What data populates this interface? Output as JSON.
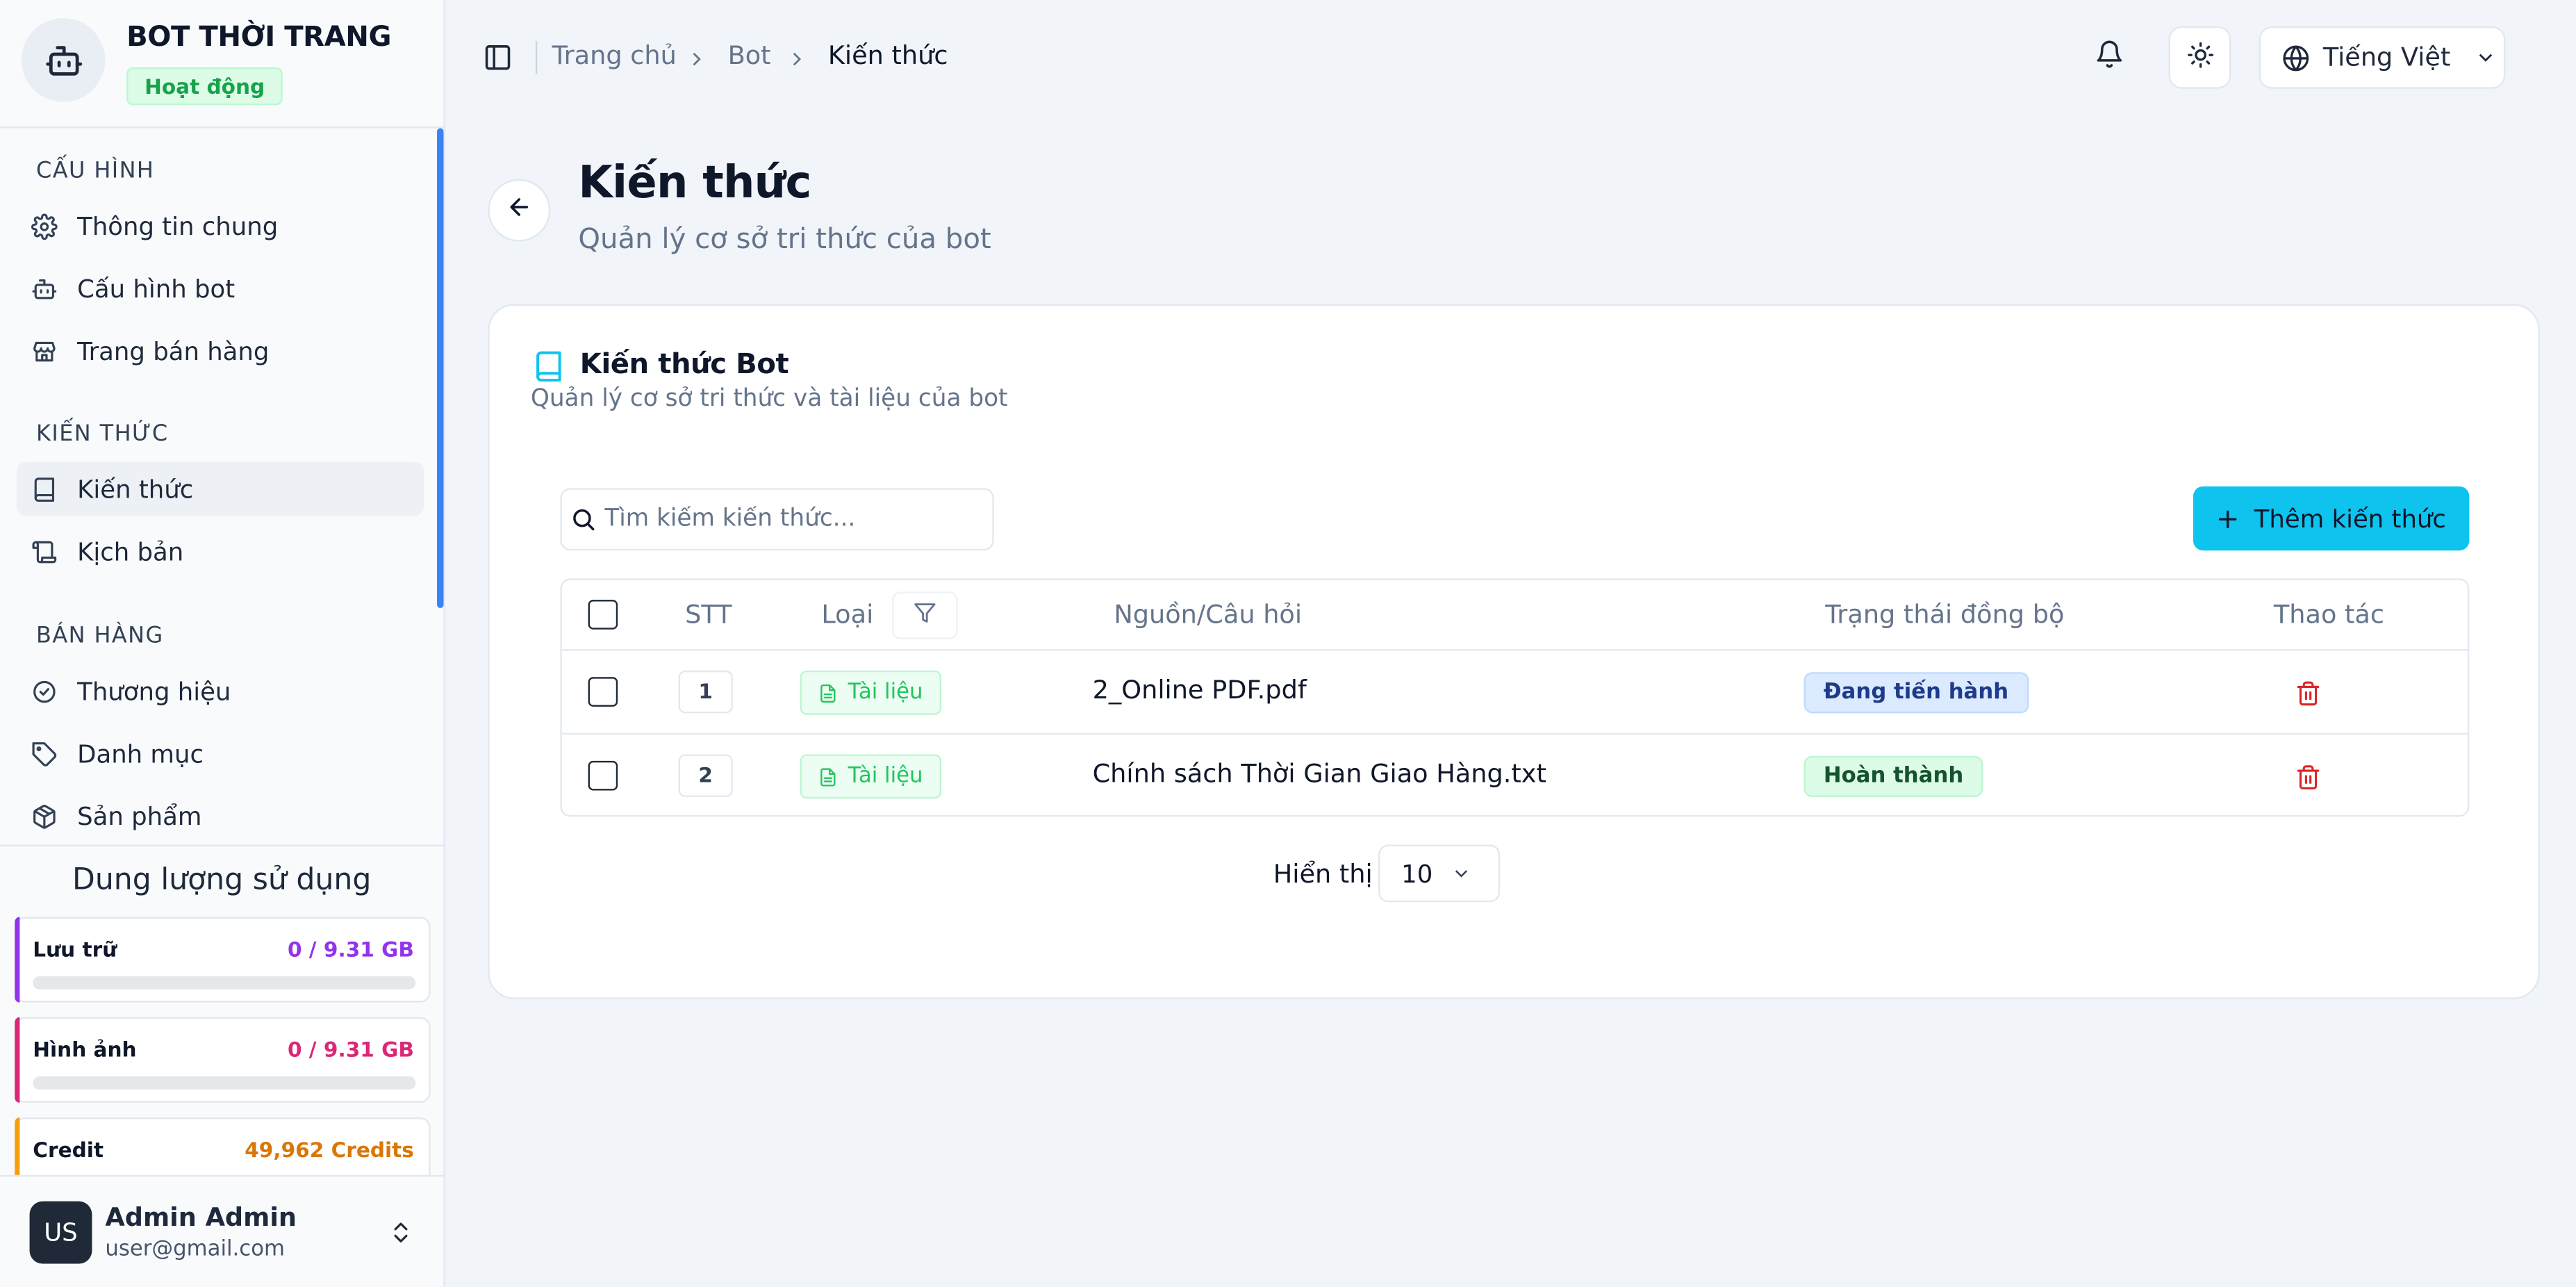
{
  "brand": {
    "title": "BOT THỜI TRANG",
    "status": "Hoạt động",
    "icon": "bot-icon"
  },
  "sidebar": {
    "sections": [
      {
        "title": "CẤU HÌNH"
      },
      {
        "title": "KIẾN THỨC"
      },
      {
        "title": "BÁN HÀNG"
      }
    ],
    "items": [
      {
        "label": "Thông tin chung",
        "icon": "gear-icon"
      },
      {
        "label": "Cấu hình bot",
        "icon": "bot-icon"
      },
      {
        "label": "Trang bán hàng",
        "icon": "store-icon"
      },
      {
        "label": "Kiến thức",
        "icon": "book-icon",
        "active": true
      },
      {
        "label": "Kịch bản",
        "icon": "script-icon"
      },
      {
        "label": "Thương hiệu",
        "icon": "badge-check-icon"
      },
      {
        "label": "Danh mục",
        "icon": "tag-icon"
      },
      {
        "label": "Sản phẩm",
        "icon": "package-icon"
      }
    ],
    "usage": {
      "title": "Dung lượng sử dụng",
      "cards": [
        {
          "name": "Lưu trữ",
          "value": "0 / 9.31 GB",
          "color": "#9333ea",
          "fraction": 0
        },
        {
          "name": "Hình ảnh",
          "value": "0 / 9.31 GB",
          "color": "#db2777",
          "fraction": 0
        },
        {
          "name": "Credit",
          "value": "49,962 Credits",
          "color": "#d97706"
        }
      ]
    },
    "user": {
      "initials": "US",
      "name": "Admin Admin",
      "email": "user@gmail.com"
    }
  },
  "topbar": {
    "breadcrumb": [
      "Trang chủ",
      "Bot",
      "Kiến thức"
    ],
    "language": "Tiếng Việt"
  },
  "page": {
    "title": "Kiến thức",
    "subtitle": "Quản lý cơ sở tri thức của bot"
  },
  "card": {
    "title": "Kiến thức Bot",
    "subtitle": "Quản lý cơ sở tri thức và tài liệu của bot",
    "search_placeholder": "Tìm kiếm kiến thức...",
    "add_label": "Thêm kiến thức",
    "accent": "#0ec3ee"
  },
  "table": {
    "headers": {
      "stt": "STT",
      "type": "Loại",
      "source": "Nguồn/Câu hỏi",
      "status": "Trạng thái đồng bộ",
      "actions": "Thao tác"
    },
    "rows": [
      {
        "stt": "1",
        "type": "Tài liệu",
        "source": "2_Online PDF.pdf",
        "status": "Đang tiến hành",
        "status_kind": "running"
      },
      {
        "stt": "2",
        "type": "Tài liệu",
        "source": "Chính sách Thời Gian Giao Hàng.txt",
        "status": "Hoàn thành",
        "status_kind": "done"
      }
    ]
  },
  "pager": {
    "label": "Hiển thị",
    "page_size": "10"
  }
}
